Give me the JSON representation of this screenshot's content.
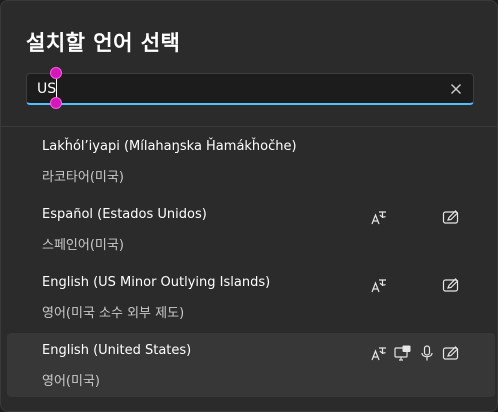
{
  "dialog": {
    "title": "설치할 언어 선택"
  },
  "search": {
    "value": "US",
    "clear_icon": "close-icon"
  },
  "languages": [
    {
      "name": "Lakȟól’iyapi (Mílahaŋska Ȟamákȟočhe)",
      "native": "라코타어(미국)",
      "features": []
    },
    {
      "name": "Español (Estados Unidos)",
      "native": "스페인어(미국)",
      "features": [
        "text-to-speech-icon",
        "handwriting-icon"
      ]
    },
    {
      "name": "English (US Minor Outlying Islands)",
      "native": "영어(미국 소수 외부 제도)",
      "features": [
        "text-to-speech-icon",
        "handwriting-icon"
      ]
    },
    {
      "name": "English (United States)",
      "native": "영어(미국)",
      "features": [
        "text-to-speech-icon",
        "display-language-icon",
        "speech-recognition-icon",
        "handwriting-icon"
      ],
      "selected": true
    }
  ],
  "colors": {
    "accent": "#4cc2ff",
    "selection_handle": "#d218b8",
    "background": "#2b2b2b",
    "selected_row": "#373737"
  }
}
